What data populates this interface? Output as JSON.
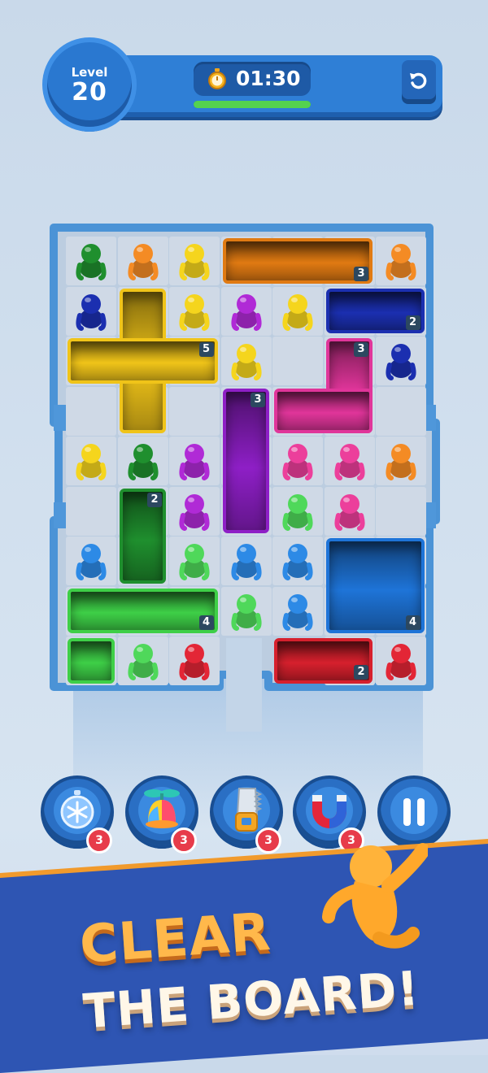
{
  "header": {
    "level_label": "Level",
    "level_number": "20",
    "timer": "01:30",
    "timer_progress": 1.0,
    "icons": [
      "stopwatch-icon",
      "restart-icon"
    ]
  },
  "board": {
    "pieces": [
      {
        "id": "orange-bar",
        "color": "#e07a12",
        "count": "3"
      },
      {
        "id": "navy-bar",
        "color": "#1b2fb0",
        "count": "2"
      },
      {
        "id": "yellow-cross",
        "color": "#f0c419",
        "count": "5"
      },
      {
        "id": "pink-l",
        "color": "#e0359a",
        "count": "3"
      },
      {
        "id": "purple-bar",
        "color": "#8e1fc6",
        "count": "3"
      },
      {
        "id": "green-small",
        "color": "#1f8f2e",
        "count": "2"
      },
      {
        "id": "green-l",
        "color": "#3ecf47",
        "count": "4"
      },
      {
        "id": "blue-square",
        "color": "#1e74d8",
        "count": "4"
      },
      {
        "id": "red-bar",
        "color": "#d6202d",
        "count": "2"
      }
    ],
    "people_colors": {
      "green": "#1f8f2e",
      "orange": "#f48b24",
      "yellow": "#f5d51d",
      "navy": "#1b2fb0",
      "purple": "#b02ad6",
      "pink": "#ec3f9b",
      "lightgreen": "#4fd85a",
      "blue": "#2d8ae6",
      "red": "#e32636"
    }
  },
  "powerups": [
    {
      "name": "freeze-time",
      "icon": "snowflake-stopwatch-icon",
      "count": "3"
    },
    {
      "name": "shuffle",
      "icon": "propeller-hat-icon",
      "count": "3"
    },
    {
      "name": "saw",
      "icon": "saw-icon",
      "count": "3"
    },
    {
      "name": "magnet",
      "icon": "magnet-icon",
      "count": "3"
    }
  ],
  "pause": {
    "icon": "pause-icon"
  },
  "banner": {
    "line1": "CLEAR",
    "line2": "THE BOARD!"
  }
}
